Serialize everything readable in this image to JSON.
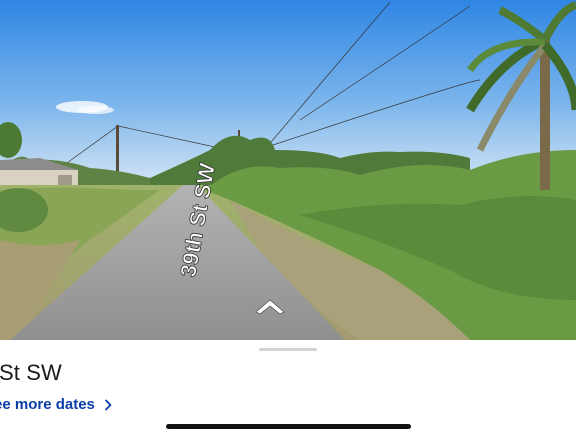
{
  "street_view": {
    "road_marking": "39th St SW",
    "nav_arrow_icon": "chevron-up-arrow-icon"
  },
  "sheet": {
    "title": "St SW",
    "dates_link": "ee more dates",
    "dates_link_icon": "chevron-right-icon"
  },
  "colors": {
    "link": "#0a3ea8",
    "title": "#1a1a1a",
    "sky_top": "#3c8fe6",
    "sky_bottom": "#cfe4f6",
    "road": "#9c9c9c",
    "grass": "#8fa95a"
  }
}
